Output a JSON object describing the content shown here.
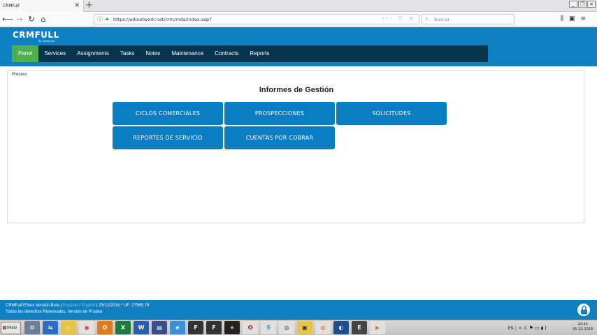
{
  "browser": {
    "tab_title": "CRMFull",
    "tab_close": "×",
    "new_tab": "+",
    "url": "https://edinetwork.net/crm/mda/index.asp?",
    "url_actions": "··· ♡ ☆",
    "search_placeholder": "Buscar",
    "window_controls": [
      "_",
      "❐",
      "×"
    ]
  },
  "app": {
    "logo": "CRMFULL",
    "logo_sub": "By Datatema",
    "menu": [
      {
        "label": "Panel",
        "active": true
      },
      {
        "label": "Services"
      },
      {
        "label": "Assignments"
      },
      {
        "label": "Tasks"
      },
      {
        "label": "Notes"
      },
      {
        "label": "Maintenance"
      },
      {
        "label": "Contracts"
      },
      {
        "label": "Reports"
      }
    ],
    "accent": "#0e7fc0",
    "menu_bg": "#07344d",
    "active_bg": "#4caf50"
  },
  "main": {
    "panel_label": "Process",
    "title": "Informes de Gestión",
    "buttons": [
      "CICLOS COMERCIALES",
      "PROSPECCIONES",
      "SOLICITUDES",
      "REPORTES DE SERVICIO",
      "CUENTAS POR COBRAR"
    ]
  },
  "footer": {
    "version": "CRMFull EServ Versión Beta",
    "lang_es": "Español",
    "lang_en": "English",
    "date_uf": "25/12/2018 * UF: 27565,79",
    "rights": "Todos los derechos Reservados, Versión de Prueba"
  },
  "taskbar": {
    "start": "Inicio",
    "lang": "ES",
    "time": "20:40",
    "date": "25-12-2018"
  }
}
